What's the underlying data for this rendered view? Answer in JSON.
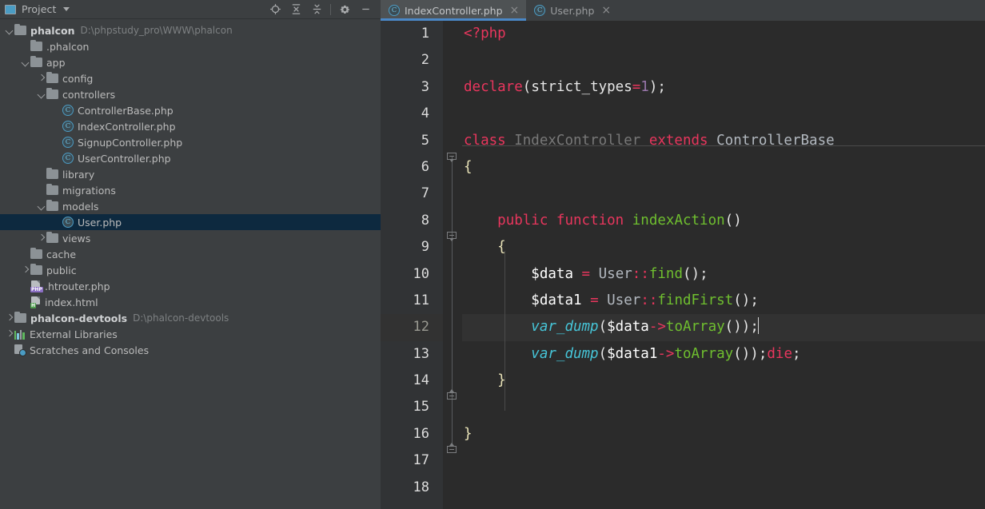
{
  "panel": {
    "title": "Project",
    "icon": "project-window-icon",
    "tools": [
      {
        "name": "locate-icon",
        "label": "Select Opened File"
      },
      {
        "name": "expand-all-icon",
        "label": "Expand All"
      },
      {
        "name": "collapse-all-icon",
        "label": "Collapse All"
      },
      {
        "name": "gear-icon",
        "label": "Settings"
      },
      {
        "name": "minimize-icon",
        "label": "Hide"
      }
    ]
  },
  "tree": [
    {
      "indent": 0,
      "arrow": "down",
      "icon": "folder",
      "label": "phalcon",
      "bold": true,
      "path": "D:\\phpstudy_pro\\WWW\\phalcon",
      "selected": false
    },
    {
      "indent": 1,
      "arrow": "none",
      "icon": "folder",
      "label": ".phalcon",
      "bold": false,
      "path": "",
      "selected": false
    },
    {
      "indent": 1,
      "arrow": "down",
      "icon": "folder",
      "label": "app",
      "bold": false,
      "path": "",
      "selected": false
    },
    {
      "indent": 2,
      "arrow": "right",
      "icon": "folder",
      "label": "config",
      "bold": false,
      "path": "",
      "selected": false
    },
    {
      "indent": 2,
      "arrow": "down",
      "icon": "folder",
      "label": "controllers",
      "bold": false,
      "path": "",
      "selected": false
    },
    {
      "indent": 3,
      "arrow": "none",
      "icon": "php-class",
      "label": "ControllerBase.php",
      "bold": false,
      "path": "",
      "selected": false
    },
    {
      "indent": 3,
      "arrow": "none",
      "icon": "php-class",
      "label": "IndexController.php",
      "bold": false,
      "path": "",
      "selected": false
    },
    {
      "indent": 3,
      "arrow": "none",
      "icon": "php-class",
      "label": "SignupController.php",
      "bold": false,
      "path": "",
      "selected": false
    },
    {
      "indent": 3,
      "arrow": "none",
      "icon": "php-class",
      "label": "UserController.php",
      "bold": false,
      "path": "",
      "selected": false
    },
    {
      "indent": 2,
      "arrow": "none",
      "icon": "folder",
      "label": "library",
      "bold": false,
      "path": "",
      "selected": false
    },
    {
      "indent": 2,
      "arrow": "none",
      "icon": "folder",
      "label": "migrations",
      "bold": false,
      "path": "",
      "selected": false
    },
    {
      "indent": 2,
      "arrow": "down",
      "icon": "folder",
      "label": "models",
      "bold": false,
      "path": "",
      "selected": false
    },
    {
      "indent": 3,
      "arrow": "none",
      "icon": "php-class",
      "label": "User.php",
      "bold": false,
      "path": "",
      "selected": true
    },
    {
      "indent": 2,
      "arrow": "right",
      "icon": "folder",
      "label": "views",
      "bold": false,
      "path": "",
      "selected": false
    },
    {
      "indent": 1,
      "arrow": "none",
      "icon": "folder",
      "label": "cache",
      "bold": false,
      "path": "",
      "selected": false
    },
    {
      "indent": 1,
      "arrow": "right",
      "icon": "folder",
      "label": "public",
      "bold": false,
      "path": "",
      "selected": false
    },
    {
      "indent": 1,
      "arrow": "none",
      "icon": "php-file",
      "label": ".htrouter.php",
      "bold": false,
      "path": "",
      "selected": false
    },
    {
      "indent": 1,
      "arrow": "none",
      "icon": "html-file",
      "label": "index.html",
      "bold": false,
      "path": "",
      "selected": false
    },
    {
      "indent": 0,
      "arrow": "right",
      "icon": "folder",
      "label": "phalcon-devtools",
      "bold": true,
      "path": "D:\\phalcon-devtools",
      "selected": false
    },
    {
      "indent": 0,
      "arrow": "right",
      "icon": "libraries",
      "label": "External Libraries",
      "bold": false,
      "path": "",
      "selected": false
    },
    {
      "indent": 0,
      "arrow": "none",
      "icon": "scratches",
      "label": "Scratches and Consoles",
      "bold": false,
      "path": "",
      "selected": false
    }
  ],
  "tabs": [
    {
      "label": "IndexController.php",
      "icon": "php-class-icon",
      "active": true,
      "close": "×"
    },
    {
      "label": "User.php",
      "icon": "php-class-icon",
      "active": false,
      "close": "×"
    }
  ],
  "editor": {
    "current_line": 12,
    "line_numbers": [
      "1",
      "2",
      "3",
      "4",
      "5",
      "6",
      "7",
      "8",
      "9",
      "10",
      "11",
      "12",
      "13",
      "14",
      "15",
      "16",
      "17",
      "18"
    ],
    "lines": [
      {
        "n": 1,
        "text": "<?php"
      },
      {
        "n": 2,
        "text": ""
      },
      {
        "n": 3,
        "text": "declare(strict_types=1);"
      },
      {
        "n": 4,
        "text": ""
      },
      {
        "n": 5,
        "text": "class IndexController extends ControllerBase"
      },
      {
        "n": 6,
        "text": "{"
      },
      {
        "n": 7,
        "text": ""
      },
      {
        "n": 8,
        "text": "    public function indexAction()"
      },
      {
        "n": 9,
        "text": "    {"
      },
      {
        "n": 10,
        "text": "        $data = User::find();"
      },
      {
        "n": 11,
        "text": "        $data1 = User::findFirst();"
      },
      {
        "n": 12,
        "text": "        var_dump($data->toArray());"
      },
      {
        "n": 13,
        "text": "        var_dump($data1->toArray());die;"
      },
      {
        "n": 14,
        "text": "    }"
      },
      {
        "n": 15,
        "text": ""
      },
      {
        "n": 16,
        "text": "}"
      },
      {
        "n": 17,
        "text": ""
      },
      {
        "n": 18,
        "text": ""
      }
    ]
  },
  "colors": {
    "sidebar_bg": "#3c3f41",
    "editor_bg": "#2b2b2b",
    "gutter_bg": "#313335",
    "selection_bg": "#0d293f",
    "current_line_bg": "#323232",
    "tab_active_underline": "#4a88c7",
    "keyword": "#e8365d",
    "function": "#6fbf2f",
    "builtin_function": "#46c5d8",
    "number": "#9876aa",
    "class_unused": "#787878"
  }
}
